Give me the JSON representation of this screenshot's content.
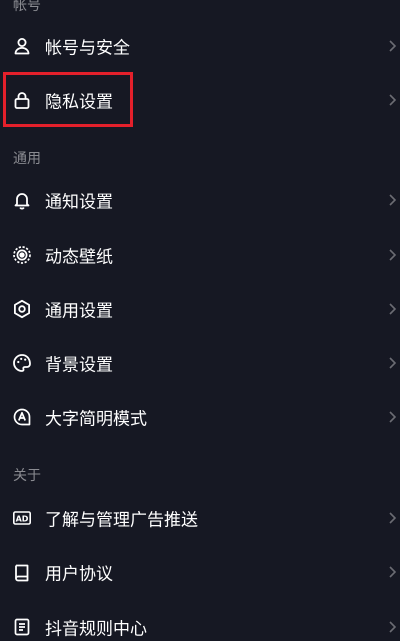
{
  "sections": {
    "account": "帐号",
    "general": "通用",
    "about": "关于"
  },
  "items": {
    "account_security": {
      "label": "帐号与安全",
      "icon": "person-icon"
    },
    "privacy": {
      "label": "隐私设置",
      "icon": "lock-icon"
    },
    "notifications": {
      "label": "通知设置",
      "icon": "bell-icon"
    },
    "live_wallpaper": {
      "label": "动态壁纸",
      "icon": "wallpaper-icon"
    },
    "general_settings": {
      "label": "通用设置",
      "icon": "gear-icon"
    },
    "background": {
      "label": "背景设置",
      "icon": "palette-icon"
    },
    "large_font": {
      "label": "大字简明模式",
      "icon": "large-font-icon"
    },
    "ads": {
      "label": "了解与管理广告推送",
      "icon": "ad-icon"
    },
    "user_agreement": {
      "label": "用户协议",
      "icon": "book-icon"
    },
    "rules_center": {
      "label": "抖音规则中心",
      "icon": "document-icon"
    }
  },
  "colors": {
    "background": "#161823",
    "text": "#ffffff",
    "section_text": "#8a8b91",
    "chevron": "#6b6c73",
    "highlight": "#e4202b"
  }
}
